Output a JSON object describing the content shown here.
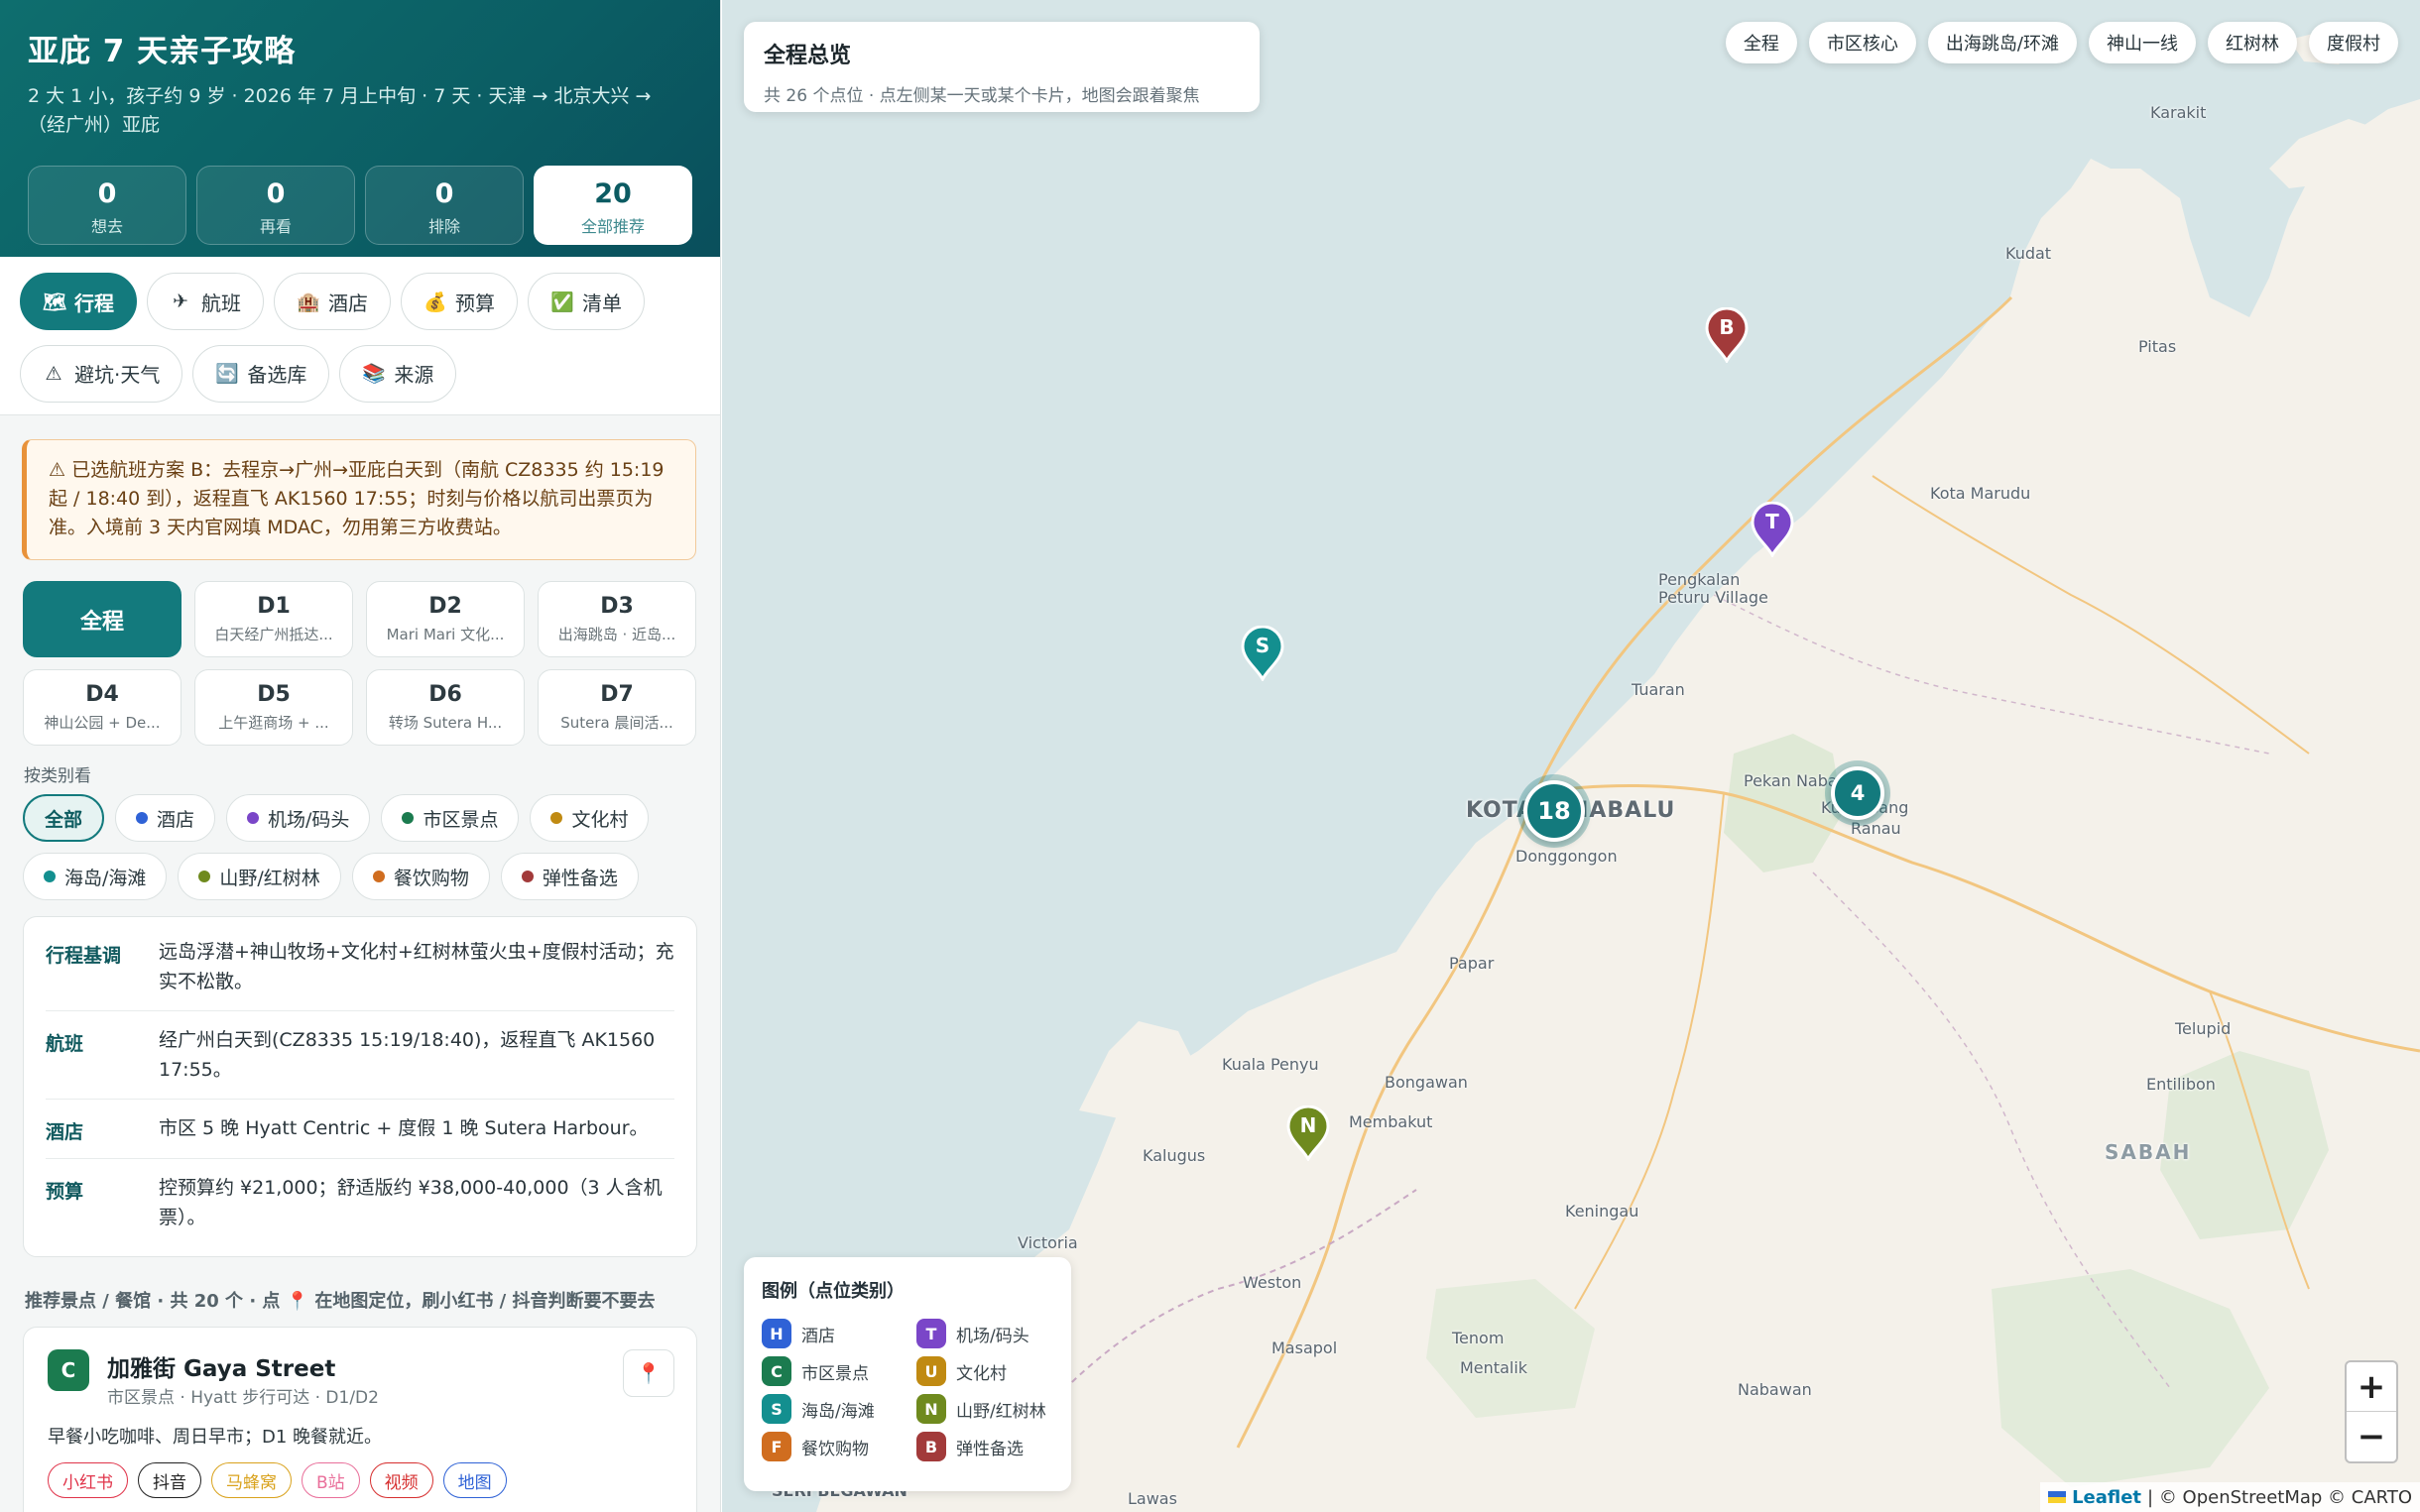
{
  "hero": {
    "title": "亚庇 7 天亲子攻略",
    "subtitle": "2 大 1 小，孩子约 9 岁 · 2026 年 7 月上中旬 · 7 天 · 天津 → 北京大兴 → （经广州）亚庇",
    "stats": [
      {
        "value": "0",
        "label": "想去"
      },
      {
        "value": "0",
        "label": "再看"
      },
      {
        "value": "0",
        "label": "排除"
      },
      {
        "value": "20",
        "label": "全部推荐"
      }
    ]
  },
  "tabs": [
    {
      "icon": "🗺",
      "label": "行程"
    },
    {
      "icon": "✈",
      "label": "航班"
    },
    {
      "icon": "🏨",
      "label": "酒店"
    },
    {
      "icon": "💰",
      "label": "预算"
    },
    {
      "icon": "✅",
      "label": "清单"
    },
    {
      "icon": "⚠",
      "label": "避坑·天气"
    },
    {
      "icon": "🔄",
      "label": "备选库"
    },
    {
      "icon": "📚",
      "label": "来源"
    }
  ],
  "alert": "⚠ 已选航班方案 B：去程京→广州→亚庇白天到（南航 CZ8335 约 15:19 起 / 18:40 到），返程直飞 AK1560 17:55；时刻与价格以航司出票页为准。入境前 3 天内官网填 MDAC，勿用第三方收费站。",
  "days": [
    {
      "day": "全程",
      "desc": ""
    },
    {
      "day": "D1",
      "desc": "白天经广州抵达..."
    },
    {
      "day": "D2",
      "desc": "Mari Mari 文化..."
    },
    {
      "day": "D3",
      "desc": "出海跳岛 · 近岛..."
    },
    {
      "day": "D4",
      "desc": "神山公园 + De..."
    },
    {
      "day": "D5",
      "desc": "上午逛商场 + ..."
    },
    {
      "day": "D6",
      "desc": "转场 Sutera H..."
    },
    {
      "day": "D7",
      "desc": "Sutera 晨间活..."
    }
  ],
  "filter_title": "按类别看",
  "filters": [
    {
      "label": "全部",
      "color": ""
    },
    {
      "label": "酒店",
      "color": "#2f62d6"
    },
    {
      "label": "机场/码头",
      "color": "#7a46c8"
    },
    {
      "label": "市区景点",
      "color": "#1b7b4f"
    },
    {
      "label": "文化村",
      "color": "#c08a12"
    },
    {
      "label": "海岛/海滩",
      "color": "#138f8f"
    },
    {
      "label": "山野/红树林",
      "color": "#6f8a1e"
    },
    {
      "label": "餐饮购物",
      "color": "#d06d1f"
    },
    {
      "label": "弹性备选",
      "color": "#a23a3a"
    }
  ],
  "summary": [
    {
      "key": "行程基调",
      "value": "远岛浮潜+神山牧场+文化村+红树林萤火虫+度假村活动；充实不松散。"
    },
    {
      "key": "航班",
      "value": "经广州白天到(CZ8335 15:19/18:40)，返程直飞 AK1560 17:55。"
    },
    {
      "key": "酒店",
      "value": "市区 5 晚 Hyatt Centric + 度假 1 晚 Sutera Harbour。"
    },
    {
      "key": "预算",
      "value": "控预算约 ¥21,000；舒适版约 ¥38,000-40,000（3 人含机票）。"
    }
  ],
  "rec_title": "推荐景点 / 餐馆 · 共 20 个 · 点 📍 在地图定位，刷小红书 / 抖音判断要不要去",
  "card": {
    "badge": "C",
    "name": "加雅街 Gaya Street",
    "meta": "市区景点 · Hyatt 步行可达 · D1/D2",
    "pin": "📍",
    "desc": "早餐小吃咖啡、周日早市；D1 晚餐就近。",
    "links": [
      {
        "label": "小红书",
        "color": "#e0344a"
      },
      {
        "label": "抖音",
        "color": "#222222"
      },
      {
        "label": "马蜂窝",
        "color": "#d9a21c"
      },
      {
        "label": "B站",
        "color": "#e96f9a"
      },
      {
        "label": "视频",
        "color": "#d62f2f"
      },
      {
        "label": "地图",
        "color": "#2f62d6"
      }
    ]
  },
  "map": {
    "overview_title": "全程总览",
    "overview_sub": "共 26 个点位 · 点左侧某一天或某个卡片，地图会跟着聚焦",
    "quick": [
      "全程",
      "市区核心",
      "出海跳岛/环滩",
      "神山一线",
      "红树林",
      "度假村"
    ],
    "places": [
      {
        "name": "Karakit"
      },
      {
        "name": "Kudat"
      },
      {
        "name": "Pitas"
      },
      {
        "name": "Kota Marudu"
      },
      {
        "name": "Pengkalan Peturu Village"
      },
      {
        "name": "Tuaran"
      },
      {
        "name": "KOTA KINABALU"
      },
      {
        "name": "Donggongon"
      },
      {
        "name": "Pekan Nabalu"
      },
      {
        "name": "Kundasang"
      },
      {
        "name": "Ranau"
      },
      {
        "name": "Papar"
      },
      {
        "name": "Kuala Penyu"
      },
      {
        "name": "Bongawan"
      },
      {
        "name": "Membakut"
      },
      {
        "name": "Kalugus"
      },
      {
        "name": "Victoria"
      },
      {
        "name": "Weston"
      },
      {
        "name": "Keningau"
      },
      {
        "name": "Telupid"
      },
      {
        "name": "Entilibon"
      },
      {
        "name": "SABAH"
      },
      {
        "name": "Tenom"
      },
      {
        "name": "Mentalik"
      },
      {
        "name": "Masapol"
      },
      {
        "name": "Nabawan"
      },
      {
        "name": "SERI BEGAWAN"
      },
      {
        "name": "Lawas"
      }
    ],
    "markers": [
      {
        "label": "B",
        "color": "#a23a3a"
      },
      {
        "label": "T",
        "color": "#7a46c8"
      },
      {
        "label": "S",
        "color": "#138f8f"
      },
      {
        "label": "N",
        "color": "#6f8a1e"
      }
    ],
    "clusters": [
      "18",
      "4"
    ],
    "legend_title": "图例（点位类别）",
    "legend": [
      {
        "letter": "H",
        "label": "酒店",
        "color": "#2f62d6"
      },
      {
        "letter": "T",
        "label": "机场/码头",
        "color": "#7a46c8"
      },
      {
        "letter": "C",
        "label": "市区景点",
        "color": "#1b7b4f"
      },
      {
        "letter": "U",
        "label": "文化村",
        "color": "#c08a12"
      },
      {
        "letter": "S",
        "label": "海岛/海滩",
        "color": "#138f8f"
      },
      {
        "letter": "N",
        "label": "山野/红树林",
        "color": "#6f8a1e"
      },
      {
        "letter": "F",
        "label": "餐饮购物",
        "color": "#d06d1f"
      },
      {
        "letter": "B",
        "label": "弹性备选",
        "color": "#a23a3a"
      }
    ],
    "zoom_in": "+",
    "zoom_out": "−",
    "attribution_leaflet": "Leaflet",
    "attribution_rest": "| © OpenStreetMap © CARTO"
  }
}
